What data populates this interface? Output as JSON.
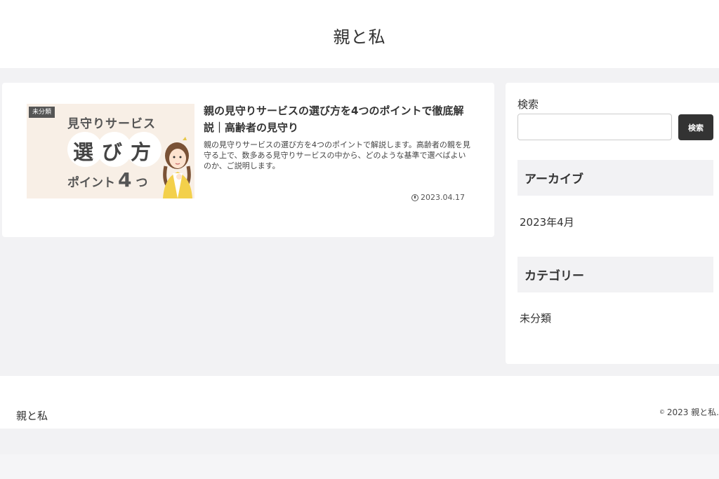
{
  "header": {
    "site_title": "親と私"
  },
  "post": {
    "category": "未分類",
    "thumbnail": {
      "line1": "見守りサービス",
      "line2": "選び方",
      "line3_text": "ポイント",
      "line3_number": "4",
      "line3_suffix": "つ"
    },
    "title": "親の見守りサービスの選び方を4つのポイントで徹底解説｜高齢者の見守り",
    "excerpt": "親の見守りサービスの選び方を4つのポイントで解説します。高齢者の親を見守る上で、数多ある見守りサービスの中から、どのような基準で選べばよいのか、ご説明します。",
    "date": "2023.04.17"
  },
  "sidebar": {
    "search_label": "検索",
    "search_value": "",
    "search_button": "検索",
    "archive_heading": "アーカイブ",
    "archive_items": [
      "2023年4月"
    ],
    "category_heading": "カテゴリー",
    "category_items": [
      "未分類"
    ]
  },
  "footer": {
    "logo": "親と私",
    "copyright_symbol": "©",
    "copyright_text": "2023 親と私."
  },
  "colors": {
    "page_background": "#f2f2f4",
    "card_background": "#ffffff",
    "button_dark": "#333333",
    "thumbnail_background": "#f8efe6"
  },
  "icons": {
    "date": "clock-icon"
  }
}
